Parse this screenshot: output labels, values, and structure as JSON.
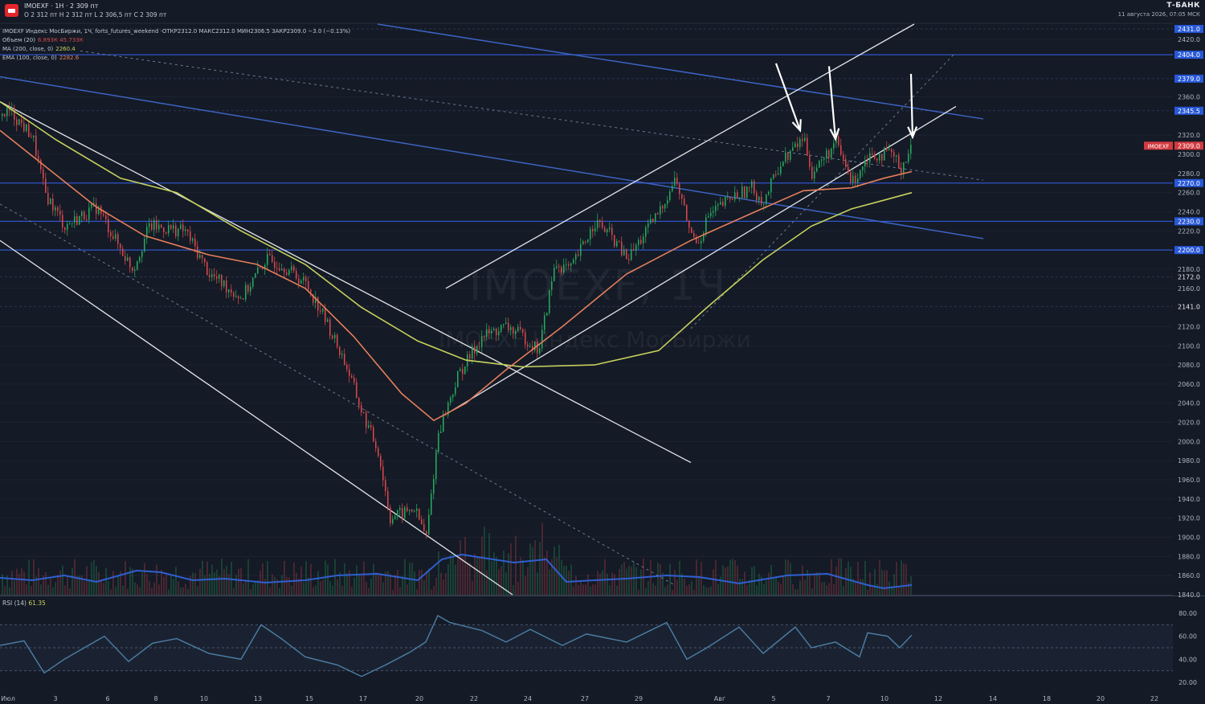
{
  "header": {
    "symbol_line": "IMOEXF · 1H · 2 309 пт",
    "ohlc_line": "O 2 312 пт  H 2 312 пт  L 2 306,5 пт  C 2 309 пт",
    "brand": "Т-БАНК",
    "datetime": "11 августа 2026, 07:05 МСК"
  },
  "legend": {
    "main": "IMOEXF Индекс МосБиржи, 1Ч, forts_futures_weekend ·ОТКР2312.0  МАКС2312.0  МИН2306.5  ЗАКР2309.0  −3.0 (−0.13%)",
    "volume_label": "Объем (20)",
    "volume_values": "6.893К  45.733К",
    "ma_label": "MA (200, close, 0)",
    "ma_value": "2260.4",
    "ema_label": "EMA (100, close, 0)",
    "ema_value": "2282.6",
    "rsi_label": "RSI (14)",
    "rsi_value": "61.35"
  },
  "watermark": {
    "line1": "IMOEXF, 1Ч",
    "line2": "IMOEXF Индекс МосБиржи"
  },
  "colors": {
    "background": "#141a26",
    "candle_up": "#26a65b",
    "candle_down": "#d2474a",
    "ma200": "#c7d25c",
    "ema100": "#e57e5a",
    "volume_line": "#2f5fd0",
    "blue_level": "#2f54c8",
    "rsi_line": "#4d7fa6",
    "price_tag": "#d23a3f",
    "level_tag": "#2858d8"
  },
  "chart_data": {
    "type": "candlestick",
    "symbol": "IMOEXF",
    "timeframe": "1H",
    "last_price": 2309.0,
    "last_price_label": "IMOEXF",
    "y_axis": {
      "ylim": [
        1840,
        2436
      ],
      "ticks": [
        2420,
        2360,
        2320,
        2300,
        2280,
        2260,
        2240,
        2220,
        2180,
        2160,
        2120,
        2100,
        2080,
        2060,
        2040,
        2020,
        2000,
        1980,
        1960,
        1940,
        1920,
        1900,
        1880,
        1860,
        1840
      ]
    },
    "price_levels": [
      2431.0,
      2404.0,
      2379.0,
      2345.5,
      2270.0,
      2230.0,
      2200.0,
      2172.0,
      2141.0
    ],
    "x_axis": {
      "labels": [
        "Июл",
        "3",
        "6",
        "8",
        "10",
        "13",
        "15",
        "17",
        "20",
        "22",
        "24",
        "27",
        "29",
        "Авг",
        "5",
        "7",
        "10",
        "12",
        "14",
        "18",
        "20",
        "22"
      ]
    },
    "price_path": [
      [
        0,
        2340
      ],
      [
        12,
        2345
      ],
      [
        40,
        2318
      ],
      [
        55,
        2260
      ],
      [
        80,
        2225
      ],
      [
        120,
        2245
      ],
      [
        150,
        2200
      ],
      [
        165,
        2180
      ],
      [
        185,
        2225
      ],
      [
        230,
        2220
      ],
      [
        260,
        2175
      ],
      [
        300,
        2150
      ],
      [
        330,
        2190
      ],
      [
        350,
        2185
      ],
      [
        380,
        2165
      ],
      [
        400,
        2135
      ],
      [
        430,
        2080
      ],
      [
        450,
        2030
      ],
      [
        470,
        1990
      ],
      [
        485,
        1920
      ],
      [
        500,
        1925
      ],
      [
        515,
        1930
      ],
      [
        530,
        1900
      ],
      [
        545,
        2010
      ],
      [
        570,
        2070
      ],
      [
        600,
        2110
      ],
      [
        630,
        2120
      ],
      [
        650,
        2110
      ],
      [
        670,
        2095
      ],
      [
        690,
        2185
      ],
      [
        710,
        2180
      ],
      [
        740,
        2230
      ],
      [
        760,
        2215
      ],
      [
        780,
        2190
      ],
      [
        800,
        2215
      ],
      [
        820,
        2240
      ],
      [
        840,
        2275
      ],
      [
        860,
        2215
      ],
      [
        870,
        2210
      ],
      [
        880,
        2235
      ],
      [
        910,
        2255
      ],
      [
        935,
        2265
      ],
      [
        950,
        2250
      ],
      [
        970,
        2290
      ],
      [
        1000,
        2318
      ],
      [
        1010,
        2280
      ],
      [
        1040,
        2312
      ],
      [
        1060,
        2270
      ],
      [
        1080,
        2300
      ],
      [
        1110,
        2300
      ],
      [
        1120,
        2285
      ],
      [
        1135,
        2309
      ]
    ],
    "ema100_path": [
      [
        0,
        2325
      ],
      [
        60,
        2285
      ],
      [
        120,
        2245
      ],
      [
        180,
        2215
      ],
      [
        260,
        2195
      ],
      [
        320,
        2185
      ],
      [
        380,
        2160
      ],
      [
        440,
        2110
      ],
      [
        500,
        2050
      ],
      [
        540,
        2022
      ],
      [
        580,
        2040
      ],
      [
        630,
        2075
      ],
      [
        700,
        2120
      ],
      [
        780,
        2175
      ],
      [
        860,
        2210
      ],
      [
        940,
        2240
      ],
      [
        1000,
        2262
      ],
      [
        1060,
        2265
      ],
      [
        1100,
        2275
      ],
      [
        1135,
        2282
      ]
    ],
    "ma200_path": [
      [
        0,
        2355
      ],
      [
        70,
        2315
      ],
      [
        150,
        2275
      ],
      [
        220,
        2260
      ],
      [
        300,
        2220
      ],
      [
        380,
        2185
      ],
      [
        450,
        2140
      ],
      [
        520,
        2105
      ],
      [
        580,
        2085
      ],
      [
        650,
        2078
      ],
      [
        740,
        2080
      ],
      [
        820,
        2095
      ],
      [
        880,
        2140
      ],
      [
        950,
        2190
      ],
      [
        1010,
        2225
      ],
      [
        1060,
        2243
      ],
      [
        1100,
        2252
      ],
      [
        1135,
        2260
      ]
    ],
    "channel_lines": [
      {
        "from": [
          0,
          2355
        ],
        "to": [
          860,
          1978
        ]
      },
      {
        "from": [
          0,
          2210
        ],
        "to": [
          638,
          1840
        ]
      },
      {
        "from": [
          555,
          2160
        ],
        "to": [
          1138,
          2436
        ]
      },
      {
        "from": [
          558,
          2030
        ],
        "to": [
          1190,
          2350
        ]
      }
    ],
    "dotted_lines": [
      {
        "from": [
          0,
          2248
        ],
        "to": [
          840,
          1850
        ]
      },
      {
        "from": [
          860,
          2118
        ],
        "to": [
          1188,
          2405
        ]
      },
      {
        "from": [
          100,
          2408
        ],
        "to": [
          1224,
          2273
        ]
      }
    ],
    "trend_lines": [
      {
        "from": [
          470,
          2436
        ],
        "to": [
          1224,
          2337
        ]
      },
      {
        "from": [
          0,
          2381
        ],
        "to": [
          1224,
          2212
        ]
      }
    ],
    "arrows": [
      {
        "x_from": 966,
        "x_to": 996,
        "y_from": 2395,
        "y_to": 2325
      },
      {
        "x_from": 1032,
        "x_to": 1040,
        "y_from": 2392,
        "y_to": 2316
      },
      {
        "x_from": 1134,
        "x_to": 1136,
        "y_from": 2384,
        "y_to": 2318
      }
    ],
    "volume_profile_path": [
      [
        0,
        21
      ],
      [
        40,
        18
      ],
      [
        80,
        24
      ],
      [
        120,
        16
      ],
      [
        170,
        30
      ],
      [
        200,
        28
      ],
      [
        240,
        18
      ],
      [
        280,
        20
      ],
      [
        330,
        15
      ],
      [
        380,
        18
      ],
      [
        420,
        24
      ],
      [
        470,
        26
      ],
      [
        520,
        18
      ],
      [
        550,
        44
      ],
      [
        575,
        50
      ],
      [
        600,
        46
      ],
      [
        640,
        40
      ],
      [
        680,
        44
      ],
      [
        705,
        16
      ],
      [
        740,
        18
      ],
      [
        780,
        20
      ],
      [
        830,
        24
      ],
      [
        870,
        22
      ],
      [
        920,
        14
      ],
      [
        980,
        24
      ],
      [
        1030,
        26
      ],
      [
        1080,
        12
      ],
      [
        1100,
        8
      ],
      [
        1135,
        12
      ]
    ],
    "rsi": {
      "label": "RSI (14)",
      "value": 61.35,
      "ylim": [
        15,
        85
      ],
      "ticks": [
        80,
        60,
        40,
        20
      ],
      "levels": [
        70,
        50,
        30
      ],
      "path": [
        [
          0,
          52
        ],
        [
          30,
          56
        ],
        [
          55,
          28
        ],
        [
          80,
          40
        ],
        [
          110,
          52
        ],
        [
          130,
          60
        ],
        [
          160,
          38
        ],
        [
          190,
          54
        ],
        [
          220,
          58
        ],
        [
          260,
          45
        ],
        [
          300,
          40
        ],
        [
          325,
          70
        ],
        [
          350,
          58
        ],
        [
          380,
          42
        ],
        [
          420,
          35
        ],
        [
          450,
          25
        ],
        [
          480,
          35
        ],
        [
          510,
          46
        ],
        [
          530,
          55
        ],
        [
          545,
          78
        ],
        [
          560,
          72
        ],
        [
          600,
          65
        ],
        [
          630,
          55
        ],
        [
          660,
          66
        ],
        [
          700,
          52
        ],
        [
          730,
          62
        ],
        [
          780,
          55
        ],
        [
          830,
          72
        ],
        [
          855,
          40
        ],
        [
          880,
          50
        ],
        [
          920,
          68
        ],
        [
          950,
          45
        ],
        [
          990,
          68
        ],
        [
          1010,
          50
        ],
        [
          1040,
          55
        ],
        [
          1070,
          42
        ],
        [
          1080,
          63
        ],
        [
          1105,
          60
        ],
        [
          1120,
          50
        ],
        [
          1135,
          61
        ]
      ]
    }
  }
}
